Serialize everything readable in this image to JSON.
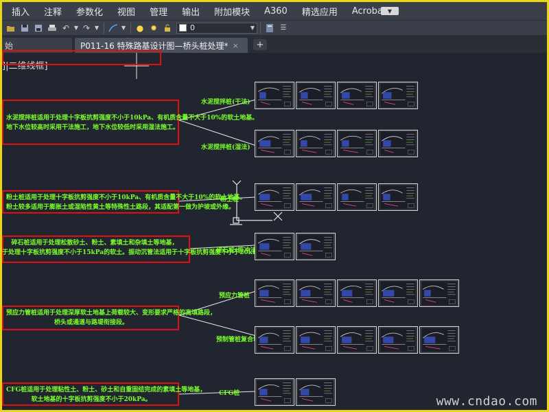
{
  "menu": {
    "items": [
      "插入",
      "注释",
      "参数化",
      "视图",
      "管理",
      "输出",
      "附加模块",
      "A360",
      "精选应用",
      "Acrobat"
    ]
  },
  "toolbar": {
    "layer_value": "0"
  },
  "tabs": {
    "start_label": "始",
    "active_label": "P011-16 特殊路基设计图—桥头桩处理*",
    "close_glyph": "×",
    "add_glyph": "+"
  },
  "canvas": {
    "viewport_label": "]|二维线框]",
    "watermark": "www.cndao.com",
    "notes": [
      {
        "lines": [
          "水泥搅拌桩适用于处理十字板抗剪强度不小于10kPa、有机质含量不大于10%的软土地基。",
          "地下水位较高时采用干法施工，地下水位较低时采用湿法施工。"
        ]
      },
      {
        "lines": [
          "粉土桩适用于处理十字板抗剪强度不小于10kPa、有机质含量不大于10%的软土地基。",
          "粉土较多适用于膨胀土或湿陷性黄土等特殊性土路段，其适配第一做为护坡或外缘。"
        ]
      },
      {
        "lines": [
          "碎石桩适用于处理松散砂土、粉土、素填土和杂填土等地基，",
          "于处理十字板抗剪强度不小于15kPa的软土。振动沉管法适用于十字板抗剪强度不小于20kPa的软土。"
        ]
      },
      {
        "lines": [
          "预应力管桩适用于处理深厚软土地基上荷载较大、变形要求严格的高填路段，",
          "桥头或通道与路堤衔接段。"
        ]
      },
      {
        "lines": [
          "CFG桩适用于处理粘性土、粉土、砂土和自重固结完成的素填土等地基，",
          "软土地基的十字板抗剪强度不小于20kPa。"
        ]
      }
    ],
    "row_labels": [
      "水泥搅拌桩(干法)",
      "水泥搅拌桩(湿法)",
      "粉土桩",
      "碎石桩(振冲法)",
      "预应力管桩",
      "预制管桩复合地基",
      "CFG桩"
    ]
  },
  "colors": {
    "canvas_bg": "#21252f",
    "note_green": "#7cff2a",
    "red_box": "#e01010",
    "window_border": "#e8d814"
  }
}
